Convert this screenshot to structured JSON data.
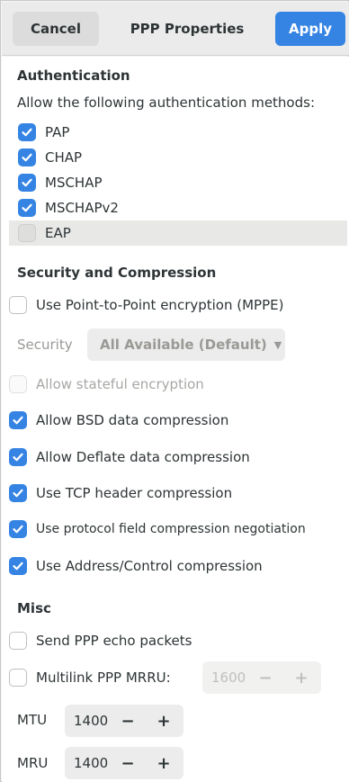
{
  "header": {
    "cancel_label": "Cancel",
    "title": "PPP Properties",
    "apply_label": "Apply"
  },
  "authentication": {
    "title": "Authentication",
    "description": "Allow the following authentication methods:",
    "methods": [
      {
        "label": "PAP",
        "checked": true
      },
      {
        "label": "CHAP",
        "checked": true
      },
      {
        "label": "MSCHAP",
        "checked": true
      },
      {
        "label": "MSCHAPv2",
        "checked": true
      },
      {
        "label": "EAP",
        "checked": false
      }
    ]
  },
  "security": {
    "title": "Security and Compression",
    "mppe_label": "Use Point-to-Point encryption (MPPE)",
    "security_label": "Security",
    "security_value": "All Available (Default)",
    "stateful_label": "Allow stateful encryption",
    "bsd_label": "Allow BSD data compression",
    "deflate_label": "Allow Deflate data compression",
    "tcp_label": "Use TCP header compression",
    "protocol_label": "Use protocol field compression negotiation",
    "address_label": "Use Address/Control compression"
  },
  "misc": {
    "title": "Misc",
    "echo_label": "Send PPP echo packets",
    "multilink_label": "Multilink PPP MRRU:",
    "mrru_value": "1600",
    "mtu_label": "MTU",
    "mtu_value": "1400",
    "mru_label": "MRU",
    "mru_value": "1400",
    "minus": "−",
    "plus": "+"
  },
  "colors": {
    "accent": "#3584e4",
    "header_bg": "#ebebeb"
  }
}
